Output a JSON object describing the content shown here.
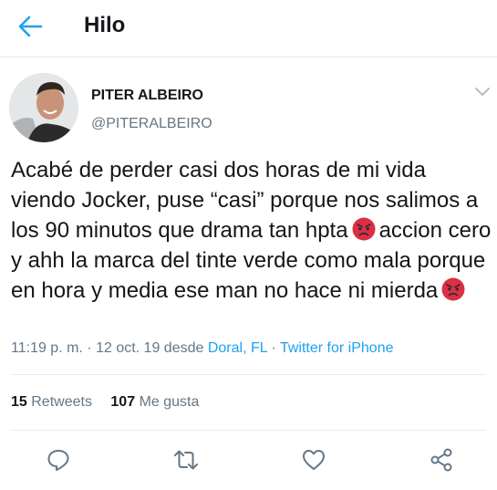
{
  "header": {
    "title": "Hilo",
    "back_icon": "arrow-left-icon",
    "accent": "#1da1f2"
  },
  "tweet": {
    "author_name": "PITER ALBEIRO",
    "author_handle": "@PITERALBEIRO",
    "text_part1": "Acabé de perder casi dos horas de mi vida viendo Jocker, puse “casi” porque nos salimos a los 90 minutos que drama tan hpta",
    "text_part2": "accion cero y ahh la marca del tinte verde como mala porque en hora y media ese man no hace ni mierda",
    "emoji": "angry-face-emoji",
    "time_date": "11:19 p. m. · 12 oct. 19 desde",
    "location": "Doral, FL",
    "separator": "·",
    "source": "Twitter for iPhone"
  },
  "stats": {
    "retweets_count": "15",
    "retweets_label": "Retweets",
    "likes_count": "107",
    "likes_label": "Me gusta"
  },
  "actions": [
    "reply-icon",
    "retweet-icon",
    "like-icon",
    "share-icon"
  ]
}
